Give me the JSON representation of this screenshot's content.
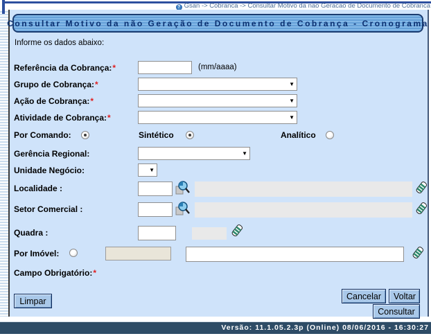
{
  "breadcrumb": {
    "text": "Gsan -> Cobranca -> Consultar Motivo da nao Geracao de Documento de Cobranca",
    "help_icon": "?"
  },
  "title": "Consultar Motivo da não Geração de Documento de Cobrança - Cronograma",
  "intro": "Informe os dados abaixo:",
  "form": {
    "referencia": {
      "label": "Referência da Cobrança:",
      "required": "*",
      "value": "",
      "hint": "(mm/aaaa)"
    },
    "grupo": {
      "label": "Grupo de Cobrança:",
      "required": "*",
      "value": ""
    },
    "acao": {
      "label": "Ação de Cobrança:",
      "required": "*",
      "value": ""
    },
    "atividade": {
      "label": "Atividade de Cobrança:",
      "required": "*",
      "value": ""
    },
    "por_comando": {
      "label": "Por Comando:",
      "checked": true
    },
    "sintetico": {
      "label": "Sintético",
      "checked": true
    },
    "analitico": {
      "label": "Analítico",
      "checked": false
    },
    "gerencia": {
      "label": "Gerência Regional:",
      "value": ""
    },
    "unidade": {
      "label": "Unidade Negócio:",
      "value": ""
    },
    "localidade": {
      "label": "Localidade :",
      "value": "",
      "desc": ""
    },
    "setor": {
      "label": "Setor Comercial :",
      "value": "",
      "desc": ""
    },
    "quadra": {
      "label": "Quadra :",
      "value": "",
      "desc": ""
    },
    "por_imovel": {
      "label": "Por Imóvel:",
      "checked": false,
      "value": "",
      "desc": ""
    },
    "campo_obrigatorio": {
      "label": "Campo Obrigatório:",
      "required": "*"
    }
  },
  "buttons": {
    "limpar": "Limpar",
    "cancelar": "Cancelar",
    "voltar": "Voltar",
    "consultar": "Consultar"
  },
  "footer": {
    "version_text": "Versão: 11.1.05.2.3p (Online) 08/06/2016 - 16:30:27"
  },
  "icons": {
    "search": "search-icon",
    "eraser": "eraser-icon",
    "dropdown": "chevron-down-icon",
    "help": "help-icon"
  },
  "colors": {
    "content_bg": "#cfe3fa",
    "title_bg": "#65a0d8",
    "title_text": "#0a2f70",
    "footer_bg": "#2e4c66",
    "button_bg": "#a9c8e9",
    "required": "#e01f1f",
    "breadcrumb_text": "#4d6d96"
  }
}
